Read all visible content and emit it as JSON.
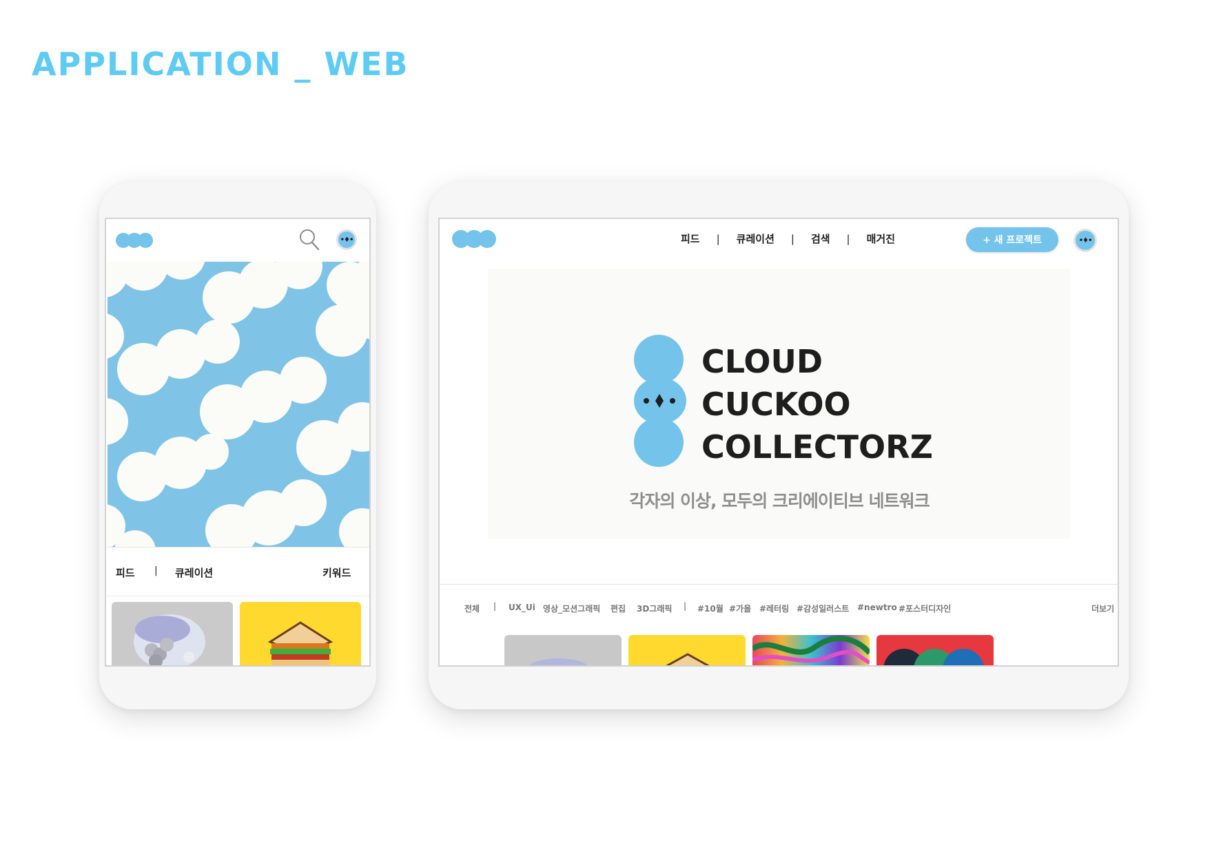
{
  "heading": "APPLICATION _ WEB",
  "colors": {
    "accent": "#5ecbf3",
    "brand_blue": "#74c3ea",
    "text_dark": "#1e1e1e",
    "muted": "#8e8e8e"
  },
  "icons": {
    "logo": "cloud-logo",
    "search": "search-icon",
    "avatar": "cuckoo-avatar-icon"
  },
  "avatar_glyph": "•♦•",
  "phone": {
    "tabs": {
      "feed": "피드",
      "separator": "|",
      "curation": "큐레이션",
      "keyword": "키워드"
    }
  },
  "tablet": {
    "nav": {
      "feed": "피드",
      "curation": "큐레이션",
      "search": "검색",
      "magazine": "매거진",
      "separator": "|"
    },
    "new_project": "+ 새 프로젝트",
    "hero": {
      "brand_lines": [
        "CLOUD",
        "CUCKOO",
        "COLLECTORZ"
      ],
      "tagline": "각자의 이상, 모두의 크리에이티브 네트워크"
    },
    "filters": {
      "all": "전체",
      "separator": "|",
      "categories": [
        "UX_Ui",
        "영상_모션그래픽",
        "편집",
        "3D그래픽"
      ],
      "tags": [
        "#10월",
        "#가을",
        "#레터링",
        "#감성일러스트",
        "#newtro",
        "#포스터디자인"
      ],
      "more": "더보기"
    }
  }
}
